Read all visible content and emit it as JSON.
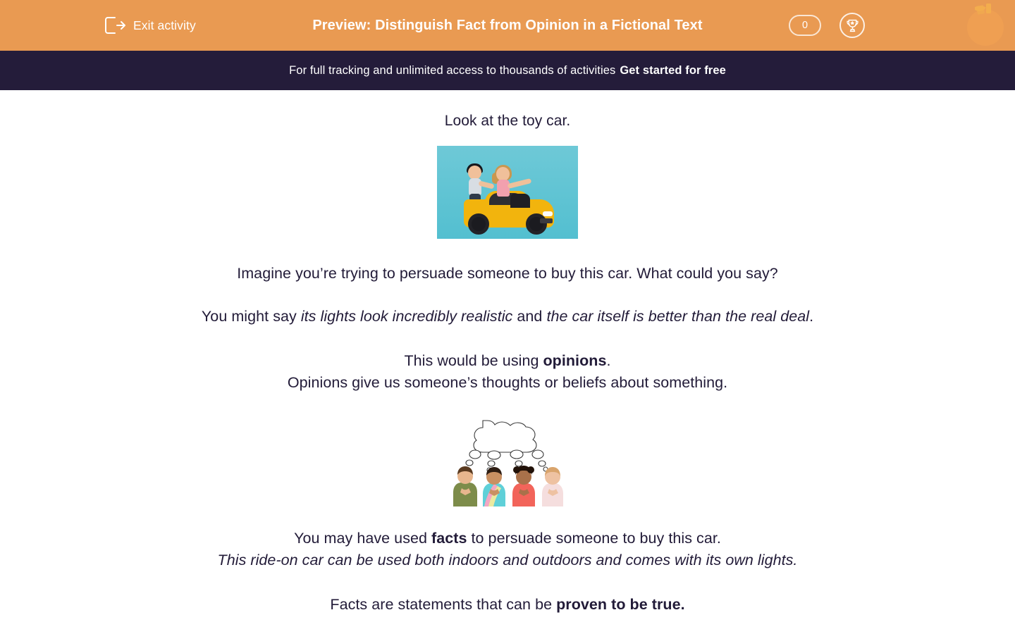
{
  "header": {
    "exit_label": "Exit activity",
    "exit_icon": "exit-arrow-icon",
    "title": "Preview: Distinguish Fact from Opinion in a Fictional Text",
    "score": "0",
    "trophy_icon": "trophy-icon",
    "brand_icon": "orange-fruit-logo",
    "bg_color": "#e99a52"
  },
  "promo": {
    "text": "For full tracking and unlimited access to thousands of activities",
    "cta": "Get started for free",
    "bg_color": "#241c3a"
  },
  "content": {
    "line1": "Look at the toy car.",
    "car_image_alt": "Two children playing with a yellow ride-on toy car on a blue background",
    "line2": "Imagine you’re trying to persuade someone to buy this car. What could you say?",
    "line3_a": "You might say ",
    "line3_em1": "its lights look incredibly realistic",
    "line3_b": " and ",
    "line3_em2": "the car itself is better than the real deal",
    "line3_c": ".",
    "line4_a": "This would be using ",
    "line4_strong": "opinions",
    "line4_b": ".",
    "line5": "Opinions give us someone’s thoughts or beliefs about something.",
    "think_image_alt": "Four children thinking with a shared thought bubble above them",
    "line6_a": "You may have used ",
    "line6_strong": "facts",
    "line6_b": " to persuade someone to buy this car.",
    "line7": "This ride-on car can be used both indoors and outdoors and comes with its own lights.",
    "line8_a": "Facts are statements that can be ",
    "line8_strong": "proven to be true.",
    "text_color": "#221b38"
  }
}
